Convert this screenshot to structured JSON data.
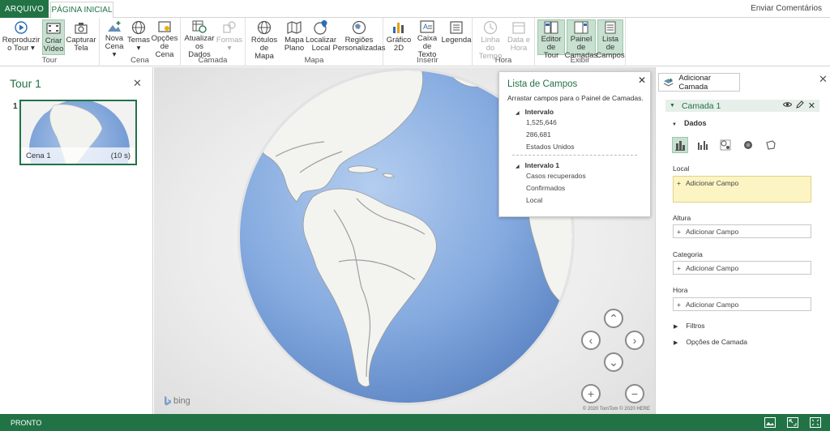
{
  "tabs": {
    "file": "ARQUIVO",
    "home": "PÁGINA INICIAL",
    "feedback": "Enviar Comentários"
  },
  "ribbon": {
    "groups": {
      "tour": "Tour",
      "scene": "Cena",
      "layer": "Camada",
      "map": "Mapa",
      "insert": "Inserir",
      "time": "Hora",
      "view": "Exibir"
    },
    "buttons": {
      "play_tour": [
        "Reproduzir",
        "o Tour ▾"
      ],
      "create_video": [
        "Criar",
        "Vídeo"
      ],
      "capture_screen": [
        "Capturar",
        "Tela"
      ],
      "new_scene": [
        "Nova",
        "Cena ▾"
      ],
      "themes": [
        "Temas",
        "▾"
      ],
      "scene_options": [
        "Opções",
        "de Cena"
      ],
      "refresh_data": [
        "Atualizar",
        "os Dados"
      ],
      "shapes": [
        "Formas",
        "▾"
      ],
      "map_labels": [
        "Rótulos de",
        "Mapa"
      ],
      "flat_map": [
        "Mapa",
        "Plano"
      ],
      "find_location": [
        "Localizar",
        "Local"
      ],
      "custom_regions": [
        "Regiões",
        "Personalizadas"
      ],
      "chart_2d": [
        "Gráfico",
        "2D"
      ],
      "text_box": [
        "Caixa de",
        "Texto"
      ],
      "legend": [
        "Legenda",
        ""
      ],
      "timeline": [
        "Linha do",
        "Tempo"
      ],
      "date_time": [
        "Data e",
        "Hora"
      ],
      "tour_editor": [
        "Editor de",
        "Tour"
      ],
      "layer_pane": [
        "Painel de",
        "Camadas"
      ],
      "field_list": [
        "Lista de",
        "Campos"
      ]
    }
  },
  "tour_pane": {
    "title": "Tour 1",
    "scene_number": "1",
    "scene_name": "Cena 1",
    "scene_duration": "(10 s)"
  },
  "map": {
    "bing": "bing",
    "copyright": "© 2020 TomTom © 2020 HERE"
  },
  "field_list": {
    "title": "Lista de Campos",
    "subtitle": "Arrastar campos para o Painel de Camadas.",
    "group1": {
      "name": "Intervalo",
      "items": [
        "1,525,646",
        "286,681",
        "Estados Unidos"
      ]
    },
    "group2": {
      "name": "Intervalo 1",
      "items": [
        "Casos recuperados",
        "Confirmados",
        "Local"
      ]
    }
  },
  "layer_pane": {
    "add_layer": "Adicionar Camada",
    "layer_name": "Camada 1",
    "data_section": "Dados",
    "local_label": "Local",
    "height_label": "Altura",
    "category_label": "Categoria",
    "time_label": "Hora",
    "add_field": "Adicionar Campo",
    "filters": "Filtros",
    "layer_options": "Opções de Camada"
  },
  "status": {
    "text": "PRONTO"
  },
  "colors": {
    "accent": "#217346",
    "ocean": "#7fa6dd",
    "land": "#f2f2ee",
    "highlight": "#c7e0d0",
    "local_field": "#fdf4c4"
  }
}
